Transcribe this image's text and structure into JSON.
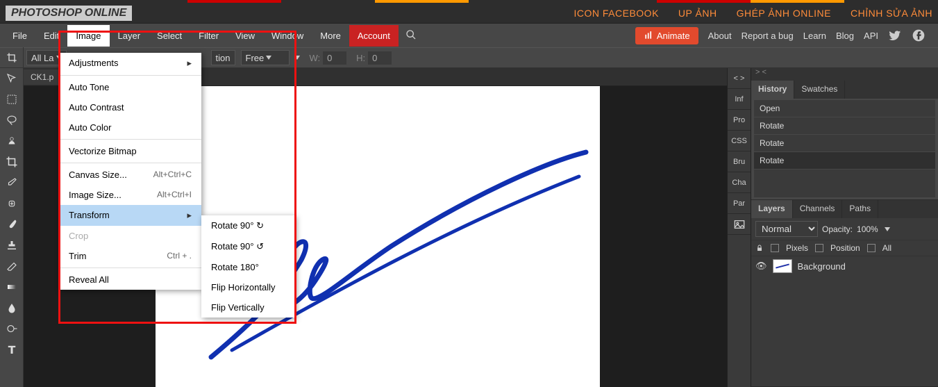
{
  "header": {
    "logo": "PHOTOSHOP ONLINE",
    "links": [
      "ICON FACEBOOK",
      "UP ẢNH",
      "GHÉP ẢNH ONLINE",
      "CHỈNH SỬA ẢNH"
    ]
  },
  "menubar": {
    "items": [
      "File",
      "Edit",
      "Image",
      "Layer",
      "Select",
      "Filter",
      "View",
      "Window",
      "More"
    ],
    "active_index": 2,
    "account": "Account",
    "right": [
      "About",
      "Report a bug",
      "Learn",
      "Blog",
      "API"
    ],
    "animate": "Animate"
  },
  "options_bar": {
    "layer_sel": "All La",
    "ratio_label": "tion",
    "ratio_value": "Free",
    "w_label": "W:",
    "w_value": "0",
    "h_label": "H:",
    "h_value": "0"
  },
  "doc_tab": "CK1.p",
  "image_menu": {
    "items": [
      {
        "label": "Adjustments",
        "sub": true
      },
      {
        "sep": true
      },
      {
        "label": "Auto Tone"
      },
      {
        "label": "Auto Contrast"
      },
      {
        "label": "Auto Color"
      },
      {
        "sep": true
      },
      {
        "label": "Vectorize Bitmap"
      },
      {
        "sep": true
      },
      {
        "label": "Canvas Size...",
        "shortcut": "Alt+Ctrl+C"
      },
      {
        "label": "Image Size...",
        "shortcut": "Alt+Ctrl+I"
      },
      {
        "label": "Transform",
        "sub": true,
        "highlight": true
      },
      {
        "label": "Crop",
        "disabled": true
      },
      {
        "label": "Trim",
        "shortcut": "Ctrl + ."
      },
      {
        "sep": true
      },
      {
        "label": "Reveal All"
      }
    ]
  },
  "transform_submenu": [
    "Rotate 90° ↻",
    "Rotate 90° ↺",
    "Rotate 180°",
    "Flip Horizontally",
    "Flip Vertically"
  ],
  "side_tabs": {
    "top": [
      "< >",
      "> <"
    ],
    "items": [
      "Inf",
      "Pro",
      "CSS",
      "Bru",
      "Cha",
      "Par"
    ]
  },
  "history_panel": {
    "tabs": [
      "History",
      "Swatches"
    ],
    "active": 0,
    "items": [
      "Open",
      "Rotate",
      "Rotate",
      "Rotate"
    ]
  },
  "layers_panel": {
    "tabs": [
      "Layers",
      "Channels",
      "Paths"
    ],
    "active": 0,
    "blend": "Normal",
    "opacity_label": "Opacity:",
    "opacity": "100%",
    "lock_labels": [
      "Pixels",
      "Position",
      "All"
    ],
    "layer_name": "Background"
  }
}
